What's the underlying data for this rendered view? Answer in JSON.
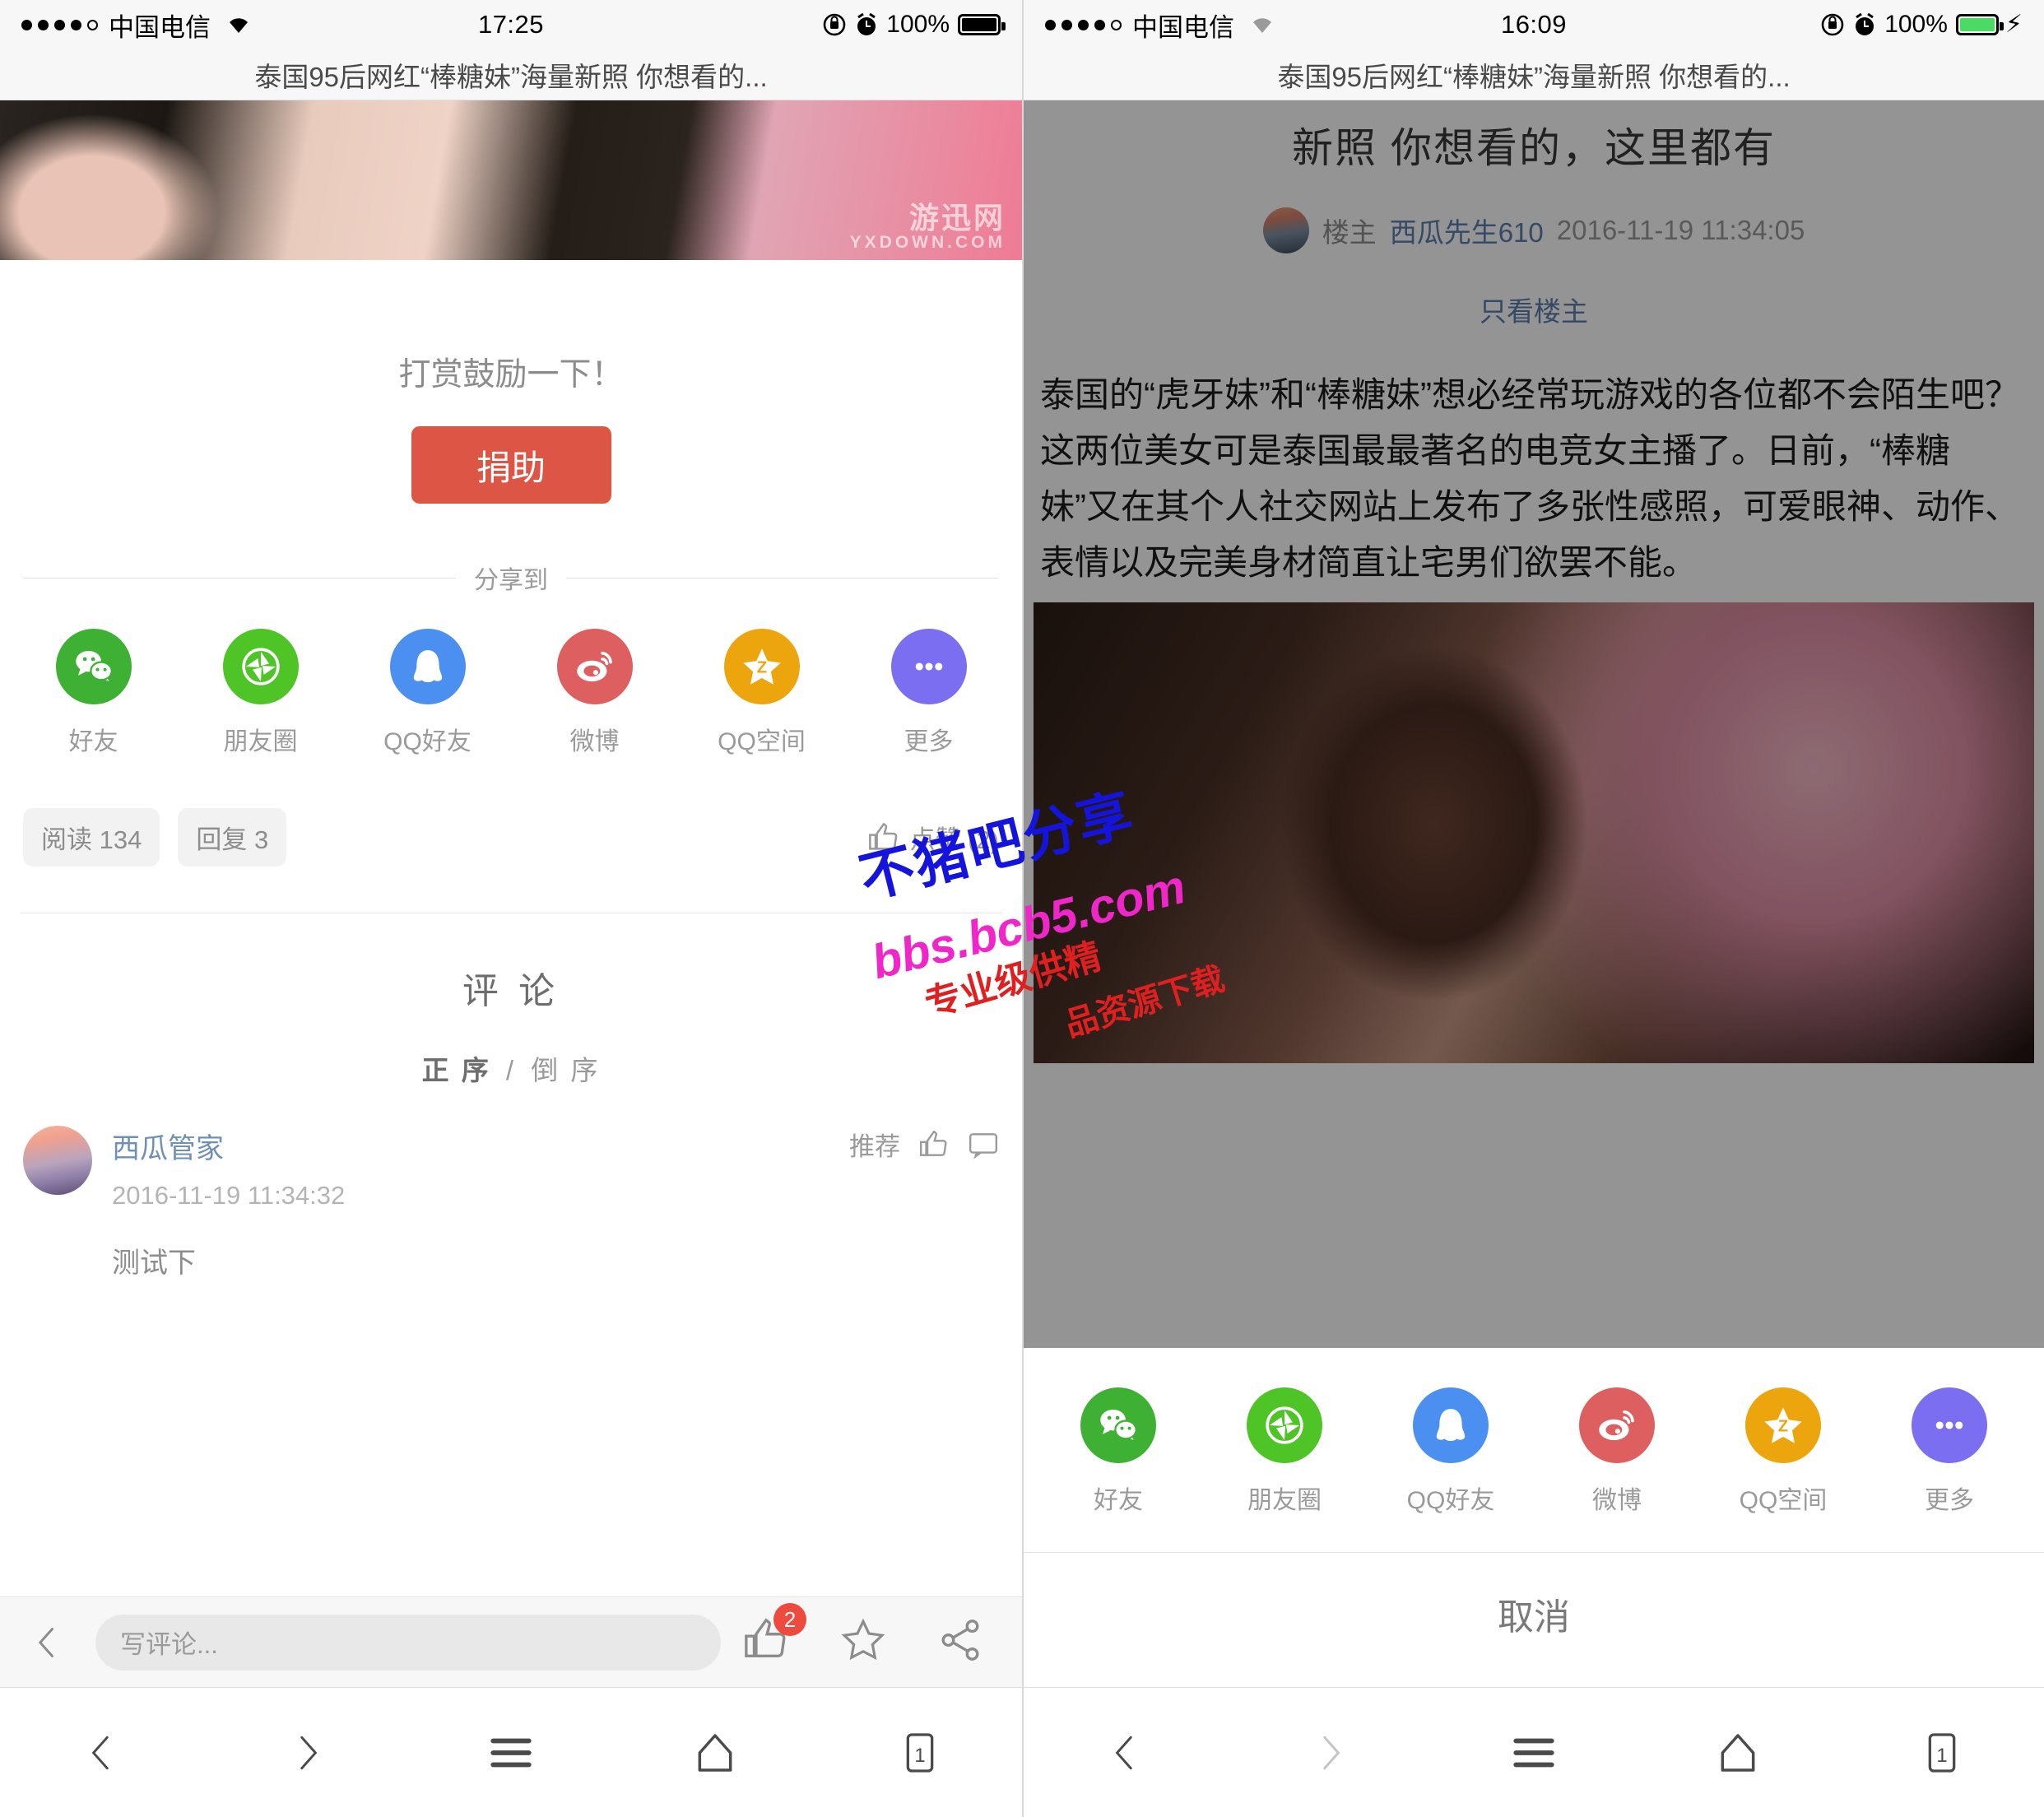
{
  "left": {
    "status": {
      "carrier": "中国电信",
      "time": "17:25",
      "battery_pct": "100%",
      "signal_dots": 5,
      "signal_filled": 4,
      "wifi_icon": "wifi-icon",
      "lock_icon": "rotation-lock-icon",
      "alarm_icon": "alarm-clock-icon",
      "battery_color": "#000000",
      "charging": false
    },
    "page_title": "泰国95后网红“棒糖妹”海量新照 你想看的...",
    "photo_watermark": {
      "main": "游迅网",
      "sub": "YXDOWN.COM"
    },
    "reward": {
      "title": "打赏鼓励一下！",
      "donate_label": "捐助",
      "donate_color": "#dd5544"
    },
    "share": {
      "header": "分享到",
      "items": [
        {
          "label": "好友",
          "icon": "wechat-icon",
          "color": "#3eb135"
        },
        {
          "label": "朋友圈",
          "icon": "moments-icon",
          "color": "#4ec426"
        },
        {
          "label": "QQ好友",
          "icon": "qq-icon",
          "color": "#4b90f0"
        },
        {
          "label": "微博",
          "icon": "weibo-icon",
          "color": "#dd5f5f"
        },
        {
          "label": "QQ空间",
          "icon": "qzone-icon",
          "color": "#eda50e"
        },
        {
          "label": "更多",
          "icon": "more-dots-icon",
          "color": "#7b6ef0"
        }
      ]
    },
    "stats": {
      "read": "阅读 134",
      "reply": "回复 3",
      "like": "点赞 (2)",
      "like_icon": "thumbs-up-icon"
    },
    "comments": {
      "title": "评 论",
      "order_asc": "正 序",
      "order_sep": "/",
      "order_desc": "倒 序",
      "list": [
        {
          "name": "西瓜管家",
          "time": "2016-11-19 11:34:32",
          "text": "测试下",
          "recommend": "推荐",
          "like_icon": "thumbs-up-icon",
          "reply_icon": "comment-bubble-icon",
          "avatar": "avatar"
        }
      ]
    },
    "scroll_top_icon": "arrow-up-icon",
    "bottombar": {
      "back_icon": "chevron-left-icon",
      "input_placeholder": "写评论...",
      "like_icon": "thumbs-up-icon",
      "like_badge": "2",
      "badge_color": "#ec4b3e",
      "favorite_icon": "star-icon",
      "share_icon": "share-nodes-icon"
    },
    "navbar": {
      "back_icon": "chevron-left-icon",
      "forward_icon": "chevron-right-icon",
      "menu_icon": "hamburger-menu-icon",
      "home_icon": "home-icon",
      "tabs_icon": "tab-count-icon",
      "tabs_count": "1"
    }
  },
  "right": {
    "status": {
      "carrier": "中国电信",
      "time": "16:09",
      "battery_pct": "100%",
      "signal_dots": 5,
      "signal_filled": 4,
      "wifi_icon": "wifi-icon",
      "lock_icon": "rotation-lock-icon",
      "alarm_icon": "alarm-clock-icon",
      "battery_color": "#4cd964",
      "charging": true,
      "bolt_icon": "lightning-bolt-icon"
    },
    "page_title": "泰国95后网红“棒糖妹”海量新照 你想看的...",
    "post": {
      "title": "新照 你想看的，这里都有",
      "author_badge": "楼主",
      "author": "西瓜先生610",
      "date": "2016-11-19 11:34:05",
      "only_author": "只看楼主",
      "body": "泰国的“虎牙妹”和“棒糖妹”想必经常玩游戏的各位都不会陌生吧？这两位美女可是泰国最最著名的电竞女主播了。日前，“棒糖妹”又在其个人社交网站上发布了多张性感照，可爱眼神、动作、表情以及完美身材简直让宅男们欲罢不能。",
      "avatar": "avatar"
    },
    "share_sheet": {
      "items": [
        {
          "label": "好友",
          "icon": "wechat-icon",
          "color": "#3eb135"
        },
        {
          "label": "朋友圈",
          "icon": "moments-icon",
          "color": "#4ec426"
        },
        {
          "label": "QQ好友",
          "icon": "qq-icon",
          "color": "#4b90f0"
        },
        {
          "label": "微博",
          "icon": "weibo-icon",
          "color": "#dd5f5f"
        },
        {
          "label": "QQ空间",
          "icon": "qzone-icon",
          "color": "#eda50e"
        },
        {
          "label": "更多",
          "icon": "more-dots-icon",
          "color": "#7b6ef0"
        }
      ],
      "cancel_label": "取消"
    },
    "navbar": {
      "back_icon": "chevron-left-icon",
      "forward_icon": "chevron-right-icon",
      "menu_icon": "hamburger-menu-icon",
      "home_icon": "home-icon",
      "tabs_icon": "tab-count-icon",
      "tabs_count": "1"
    }
  },
  "watermark": {
    "blue": "不猪吧分享",
    "pink": "bbs.bcb5.com",
    "red_line1": "专业级供精",
    "red_line2": "品资源下载",
    "blue_color": "#1414dd",
    "pink_color": "#ef27c9",
    "red_color": "#e02020"
  }
}
